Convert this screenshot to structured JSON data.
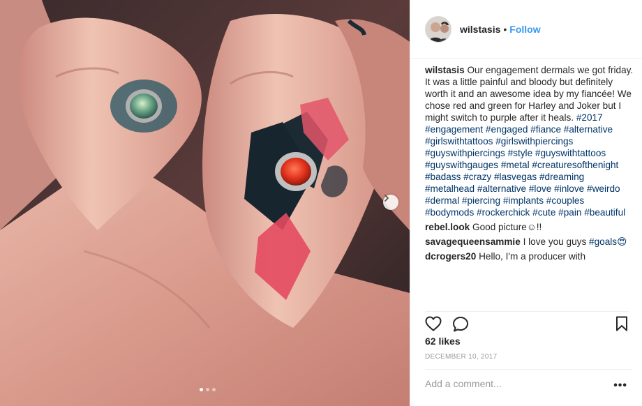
{
  "post": {
    "username": "wilstasis",
    "separator": "•",
    "follow_label": "Follow",
    "caption_user": "wilstasis",
    "caption_text": "Our engagement dermals we got friday. It was a little painful and bloody but definitely worth it and an awesome idea by my fiancée! We chose red and green for Harley and Joker but I might switch to purple after it heals.",
    "caption_hashtags": "#2017 #engagement #engaged #fiance #alternative #girlswithtattoos #girlswithpiercings #guyswithpiercings #style #guyswithtattoos #guyswithgauges #metal #creaturesofthenight #badass #crazy #lasvegas #dreaming #metalhead #alternative #love #inlove #weirdo #dermal #piercing #implants #couples #bodymods #rockerchick #cute #pain #beautiful",
    "likes": "62 likes",
    "date": "DECEMBER 10, 2017",
    "add_comment_placeholder": "Add a comment...",
    "more_label": "•••"
  },
  "comments": [
    {
      "user": "rebel.look",
      "text": "Good picture☺!!"
    },
    {
      "user": "savagequeensammie",
      "text": "I love you guys",
      "tag": "#goals😍"
    },
    {
      "user": "dcrogers20",
      "text": "Hello, I'm a producer with"
    }
  ],
  "carousel": {
    "slides": 3,
    "active_slide": 1
  },
  "icons": {
    "heart": "heart-icon",
    "comment": "comment-icon",
    "bookmark": "bookmark-icon",
    "next": "chevron-right-icon"
  },
  "colors": {
    "link_blue": "#3897f0",
    "hashtag": "#003569",
    "muted": "#999999"
  }
}
